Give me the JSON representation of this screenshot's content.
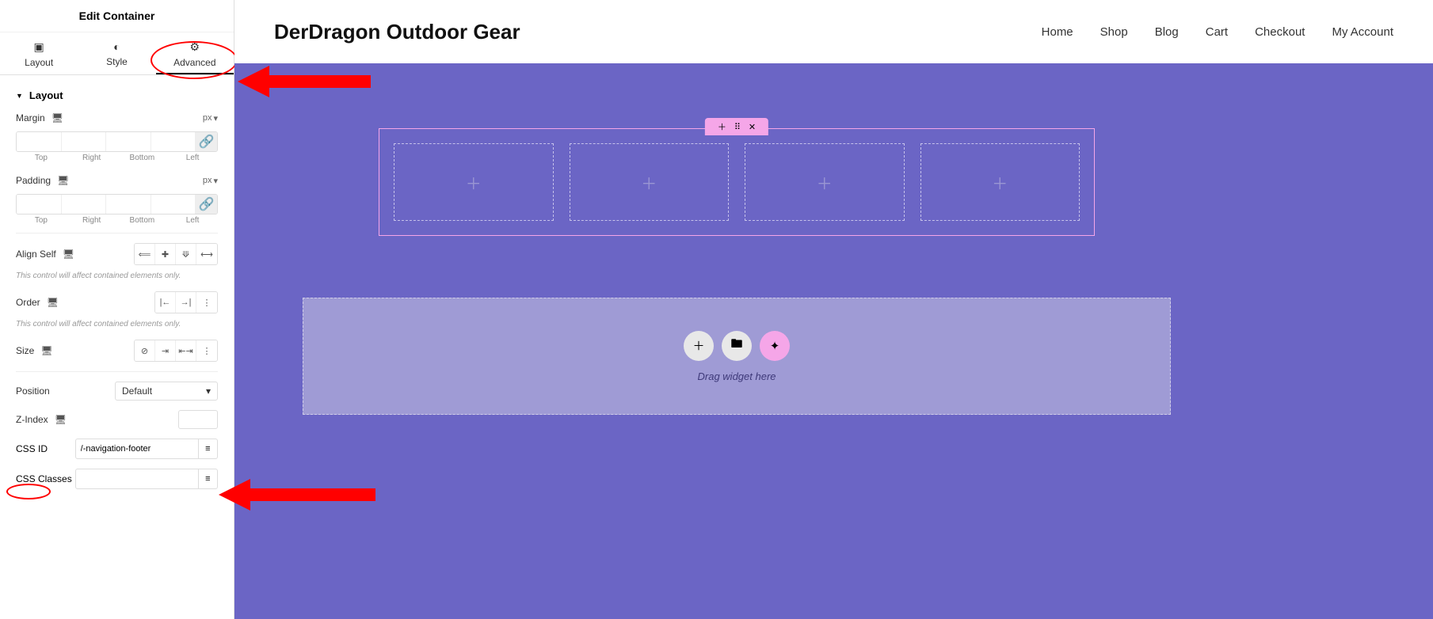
{
  "panel": {
    "title": "Edit Container",
    "tabs": {
      "layout": "Layout",
      "style": "Style",
      "advanced": "Advanced"
    },
    "section_layout": "Layout",
    "margin_label": "Margin",
    "padding_label": "Padding",
    "unit_px": "px",
    "box_sides": {
      "top": "Top",
      "right": "Right",
      "bottom": "Bottom",
      "left": "Left"
    },
    "align_self": "Align Self",
    "note_contained": "This control will affect contained elements only.",
    "order": "Order",
    "size": "Size",
    "position": "Position",
    "position_value": "Default",
    "zindex": "Z-Index",
    "cssid": "CSS ID",
    "cssid_value": "/-navigation-footer",
    "cssclasses": "CSS Classes"
  },
  "site": {
    "title": "DerDragon Outdoor Gear",
    "nav": [
      "Home",
      "Shop",
      "Blog",
      "Cart",
      "Checkout",
      "My Account"
    ]
  },
  "dropzone": {
    "text": "Drag widget here"
  }
}
